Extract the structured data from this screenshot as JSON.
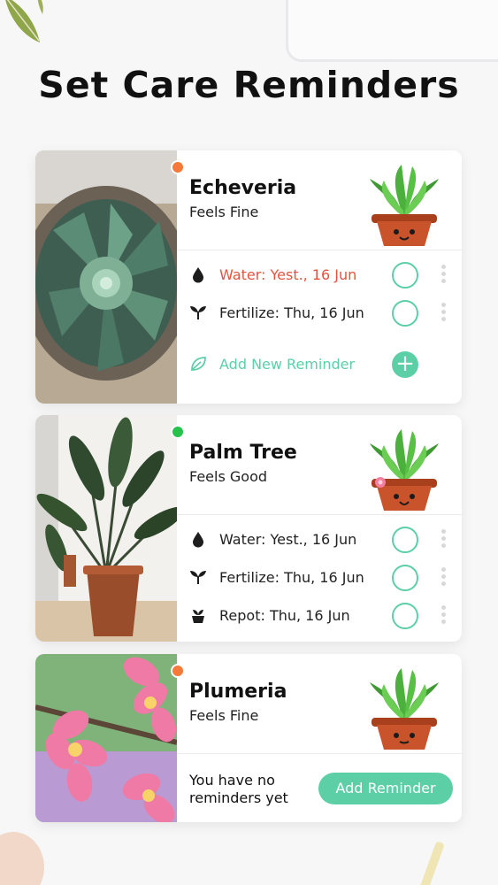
{
  "headline": "Set Care Reminders",
  "colors": {
    "accent": "#5ccfa7",
    "overdue": "#e5533f",
    "status_fine": "#f47a3a",
    "status_good": "#27c24c"
  },
  "plants": [
    {
      "name": "Echeveria",
      "feeling": "Feels Fine",
      "status_color": "#f47a3a",
      "reminders": [
        {
          "icon": "water-drop-icon",
          "label": "Water: Yest., 16 Jun",
          "overdue": true
        },
        {
          "icon": "fertilize-sprout-icon",
          "label": "Fertilize: Thu, 16 Jun",
          "overdue": false
        }
      ],
      "add_label": "Add New Reminder"
    },
    {
      "name": "Palm Tree",
      "feeling": "Feels Good",
      "status_color": "#27c24c",
      "reminders": [
        {
          "icon": "water-drop-icon",
          "label": "Water: Yest., 16 Jun",
          "overdue": false
        },
        {
          "icon": "fertilize-sprout-icon",
          "label": "Fertilize: Thu, 16 Jun",
          "overdue": false
        },
        {
          "icon": "repot-icon",
          "label": "Repot: Thu, 16 Jun",
          "overdue": false
        }
      ]
    },
    {
      "name": "Plumeria",
      "feeling": "Feels Fine",
      "status_color": "#f47a3a",
      "empty_line1": "You have no",
      "empty_line2": "reminders yet",
      "add_button": "Add Reminder"
    }
  ]
}
